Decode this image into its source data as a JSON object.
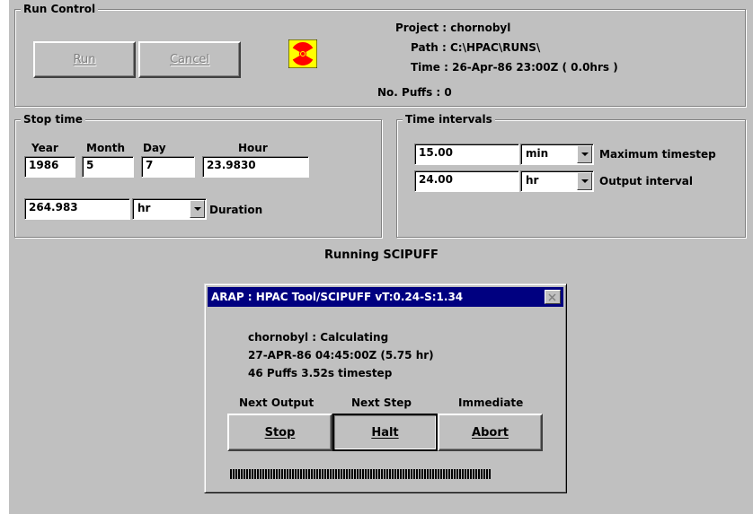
{
  "run_control": {
    "title": "Run Control",
    "run_label": "Run",
    "cancel_label": "Cancel",
    "project": "Project : chornobyl",
    "path": "Path : C:\\HPAC\\RUNS\\",
    "time": "Time : 26-Apr-86 23:00Z ( 0.0hrs )",
    "puffs": "No. Puffs : 0"
  },
  "stop_time": {
    "title": "Stop time",
    "year_label": "Year",
    "month_label": "Month",
    "day_label": "Day",
    "hour_label": "Hour",
    "year": "1986",
    "month": "5",
    "day": "7",
    "hour": "23.9830",
    "duration": "264.983",
    "duration_unit": "hr",
    "duration_label": "Duration"
  },
  "time_intervals": {
    "title": "Time intervals",
    "max_timestep": "15.00",
    "max_timestep_unit": "min",
    "max_timestep_label": "Maximum timestep",
    "output_interval": "24.00",
    "output_interval_unit": "hr",
    "output_interval_label": "Output interval"
  },
  "status": "Running SCIPUFF",
  "dialog": {
    "title": "ARAP : HPAC Tool/SCIPUFF vT:0.24-S:1.34",
    "line1": "chornobyl : Calculating",
    "line2": "27-APR-86 04:45:00Z (5.75 hr)",
    "line3": "46 Puffs  3.52s timestep",
    "next_output_label": "Next Output",
    "next_step_label": "Next Step",
    "immediate_label": "Immediate",
    "stop_label": "Stop",
    "halt_label": "Halt",
    "abort_label": "Abort"
  },
  "colors": {
    "radiation_yellow": "#ffff00",
    "radiation_red": "#ff0000",
    "titlebar": "#000080"
  }
}
